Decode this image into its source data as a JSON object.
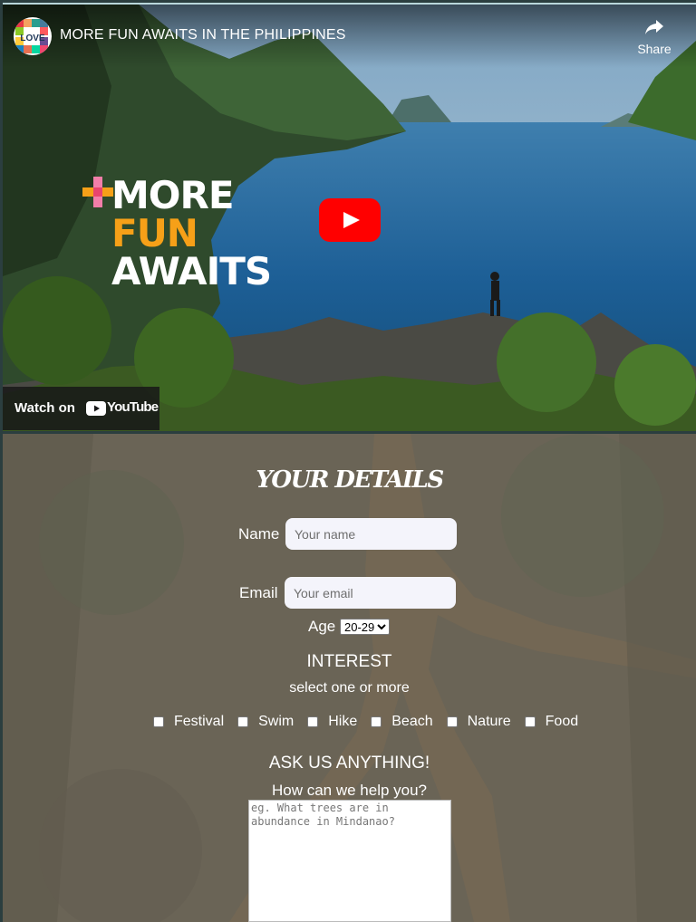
{
  "video": {
    "title": "MORE FUN AWAITS IN THE PHILIPPINES",
    "share_label": "Share",
    "brand_lines": [
      "MORE",
      "FUN",
      "AWAITS"
    ],
    "watch_on_label": "Watch on",
    "youtube_label": "YouTube",
    "channel_logo_text": "LOVE THE PHILIPPINES"
  },
  "form": {
    "heading": "Your Details",
    "name": {
      "label": "Name",
      "placeholder": "Your name"
    },
    "email": {
      "label": "Email",
      "placeholder": "Your email"
    },
    "age": {
      "label": "Age",
      "selected": "20-29"
    },
    "interest": {
      "title": "INTEREST",
      "subtitle": "select one or more",
      "options": [
        "Festival",
        "Swim",
        "Hike",
        "Beach",
        "Nature",
        "Food"
      ]
    },
    "ask": {
      "title": "ASK US ANYTHING!",
      "help": "How can we help you?",
      "placeholder": "eg. What trees are in abundance in Mindanao?"
    }
  },
  "colors": {
    "play_button": "#ff0000",
    "form_overlay": "#6b6558",
    "fun_accent": "#f6a018"
  }
}
